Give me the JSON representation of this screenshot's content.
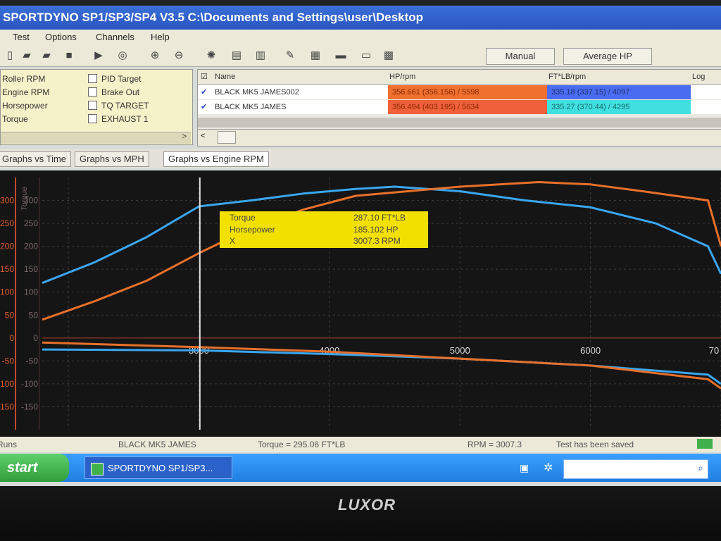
{
  "window": {
    "title": "SPORTDYNO SP1/SP3/SP4  V3.5  C:\\Documents and Settings\\user\\Desktop"
  },
  "menu": [
    "Test",
    "Options",
    "Channels",
    "Help"
  ],
  "toolbar": {
    "manual_label": "Manual",
    "average_hp_label": "Average HP"
  },
  "channels": {
    "left": [
      "Roller RPM",
      "Engine RPM",
      "Horsepower",
      "Torque"
    ],
    "right": [
      "PID Target",
      "Brake Out",
      "TQ TARGET",
      "EXHAUST 1"
    ]
  },
  "runs": {
    "headers": [
      "Name",
      "HP/rpm",
      "FT*LB/rpm",
      "Log"
    ],
    "rows": [
      {
        "name": "BLACK MK5 JAMES002",
        "hp": "356.661 (356.156) / 5598",
        "tq": "335.18 (337.15) / 4097",
        "hp_color": "#f07030",
        "tq_color": "#4a6cf0"
      },
      {
        "name": "BLACK MK5 JAMES",
        "hp": "356.494 (403.195) / 5634",
        "tq": "335.27 (370.44) / 4295",
        "hp_color": "#f0603a",
        "tq_color": "#40e0e0"
      }
    ]
  },
  "tabs": [
    "Graphs vs Time",
    "Graphs vs MPH",
    "Graphs vs Engine RPM"
  ],
  "tooltip": {
    "rows": [
      {
        "label": "Torque",
        "value": "287.10 FT*LB"
      },
      {
        "label": "Horsepower",
        "value": "185.102 HP"
      },
      {
        "label": "X",
        "value": "3007.3 RPM"
      }
    ]
  },
  "status": {
    "runs": "Runs",
    "run_name": "BLACK MK5 JAMES",
    "torque": "Torque = 295.06 FT*LB",
    "rpm": "RPM = 3007.3",
    "saved": "Test has been saved"
  },
  "taskbar": {
    "start": "start",
    "task": "SPORTDYNO SP1/SP3..."
  },
  "bezel": {
    "logo": "LUXOR"
  },
  "chart_data": {
    "type": "line",
    "xlabel": "",
    "ylabel": "Torque",
    "xlim": [
      1800,
      7000
    ],
    "ylim": [
      -200,
      350
    ],
    "x_ticks": [
      "3000",
      "4000",
      "5000",
      "6000",
      "70"
    ],
    "y_ticks": [
      "300",
      "250",
      "200",
      "150",
      "100",
      "50",
      "0",
      "-50",
      "-100",
      "-150"
    ],
    "cursor_x": 3007.3,
    "grid": true,
    "series": [
      {
        "color": "#3aa6f0",
        "x": [
          1800,
          2200,
          2600,
          3000,
          3400,
          3800,
          4200,
          4500,
          5000,
          5500,
          6000,
          6500,
          6900,
          7000
        ],
        "y": [
          120,
          165,
          220,
          287,
          300,
          315,
          325,
          330,
          320,
          300,
          285,
          250,
          200,
          140
        ]
      },
      {
        "color": "#e8702a",
        "x": [
          1800,
          2200,
          2600,
          3000,
          3400,
          3800,
          4200,
          4600,
          5000,
          5600,
          6000,
          6400,
          6900,
          7000
        ],
        "y": [
          40,
          80,
          125,
          185,
          240,
          280,
          310,
          320,
          330,
          340,
          335,
          320,
          300,
          200
        ]
      },
      {
        "color": "#3aa6f0",
        "x": [
          1800,
          3000,
          4000,
          5000,
          6000,
          6900,
          7000
        ],
        "y": [
          -25,
          -27,
          -35,
          -45,
          -60,
          -80,
          -100
        ]
      },
      {
        "color": "#e8702a",
        "x": [
          1800,
          3000,
          4000,
          5000,
          6000,
          6900,
          7000
        ],
        "y": [
          -10,
          -20,
          -30,
          -45,
          -60,
          -90,
          -110
        ]
      }
    ]
  }
}
